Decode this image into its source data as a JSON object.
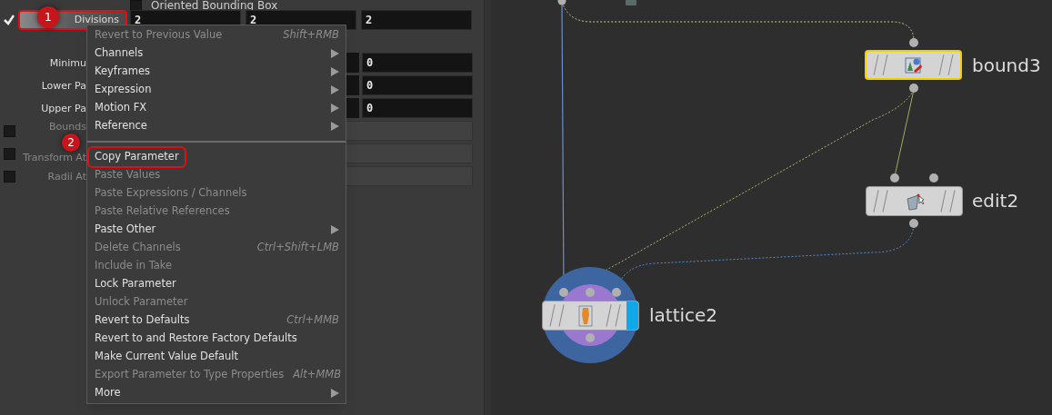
{
  "parameters": {
    "top_toggle": {
      "label": "Oriented Bounding Box",
      "checked": false
    },
    "divisions": {
      "label": "Divisions",
      "enabled": true,
      "outlined": true,
      "values": [
        "2",
        "2",
        "2"
      ]
    },
    "rows": [
      {
        "kind": "vector",
        "label": "Minimu",
        "values": [
          "0"
        ]
      },
      {
        "kind": "vector",
        "label": "Lower Pa",
        "values": [
          "0"
        ]
      },
      {
        "kind": "vector",
        "label": "Upper Pa",
        "values": [
          "0"
        ]
      },
      {
        "kind": "toggle",
        "label": "Bounds",
        "checked": false
      },
      {
        "kind": "toggle",
        "label": "Transform At",
        "checked": false
      },
      {
        "kind": "toggle",
        "label": "Radii At",
        "checked": false
      }
    ]
  },
  "context_menu": {
    "items": [
      {
        "kind": "item",
        "label": "Revert to Previous Value",
        "shortcut": "Shift+RMB",
        "disabled": true,
        "submenu": false,
        "outlined": false
      },
      {
        "kind": "item",
        "label": "Channels",
        "disabled": false,
        "submenu": true,
        "outlined": false
      },
      {
        "kind": "item",
        "label": "Keyframes",
        "disabled": false,
        "submenu": true,
        "outlined": false
      },
      {
        "kind": "item",
        "label": "Expression",
        "disabled": false,
        "submenu": true,
        "outlined": false
      },
      {
        "kind": "item",
        "label": "Motion FX",
        "disabled": false,
        "submenu": true,
        "outlined": false
      },
      {
        "kind": "item",
        "label": "Reference",
        "disabled": false,
        "submenu": true,
        "outlined": false
      },
      {
        "kind": "separator"
      },
      {
        "kind": "item",
        "label": "Copy Parameter",
        "disabled": false,
        "submenu": false,
        "outlined": true
      },
      {
        "kind": "item",
        "label": "Paste Values",
        "disabled": true,
        "submenu": false,
        "outlined": false
      },
      {
        "kind": "item",
        "label": "Paste Expressions / Channels",
        "disabled": true,
        "submenu": false,
        "outlined": false
      },
      {
        "kind": "item",
        "label": "Paste Relative References",
        "disabled": true,
        "submenu": false,
        "outlined": false
      },
      {
        "kind": "item",
        "label": "Paste Other",
        "disabled": false,
        "submenu": true,
        "outlined": false
      },
      {
        "kind": "item",
        "label": "Delete Channels",
        "shortcut": "Ctrl+Shift+LMB",
        "disabled": true,
        "submenu": false,
        "outlined": false
      },
      {
        "kind": "item",
        "label": "Include in Take",
        "disabled": true,
        "submenu": false,
        "outlined": false
      },
      {
        "kind": "item",
        "label": "Lock Parameter",
        "disabled": false,
        "submenu": false,
        "outlined": false
      },
      {
        "kind": "item",
        "label": "Unlock Parameter",
        "disabled": true,
        "submenu": false,
        "outlined": false
      },
      {
        "kind": "item",
        "label": "Revert to Defaults",
        "shortcut": "Ctrl+MMB",
        "disabled": false,
        "submenu": false,
        "outlined": false
      },
      {
        "kind": "item",
        "label": "Revert to and Restore Factory Defaults",
        "disabled": false,
        "submenu": false,
        "outlined": false
      },
      {
        "kind": "item",
        "label": "Make Current Value Default",
        "disabled": false,
        "submenu": false,
        "outlined": false
      },
      {
        "kind": "item",
        "label": "Export Parameter to Type Properties",
        "shortcut": "Alt+MMB",
        "disabled": true,
        "submenu": false,
        "outlined": false
      },
      {
        "kind": "item",
        "label": "More",
        "disabled": false,
        "submenu": true,
        "outlined": false
      }
    ]
  },
  "annotations": [
    "1",
    "2"
  ],
  "network": {
    "nodes": [
      {
        "kind": "bound",
        "name": "bound3",
        "selected": true,
        "display_flag": false
      },
      {
        "kind": "edit",
        "name": "edit2",
        "selected": false,
        "display_flag": false
      },
      {
        "kind": "lattice",
        "name": "lattice2",
        "selected": false,
        "display_flag": true
      }
    ]
  }
}
